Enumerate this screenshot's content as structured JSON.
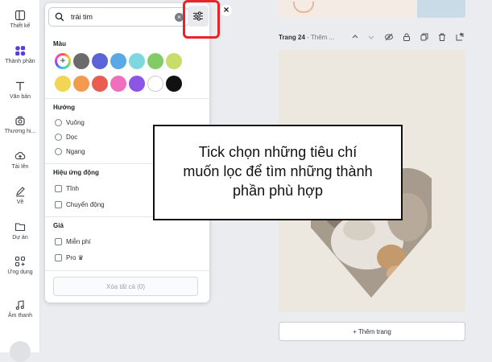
{
  "sidebar": {
    "items": [
      {
        "label": "Thiết kế",
        "icon": "layout-icon"
      },
      {
        "label": "Thành phần",
        "icon": "elements-icon"
      },
      {
        "label": "Văn bản",
        "icon": "text-icon"
      },
      {
        "label": "Thương hi...",
        "icon": "brand-icon"
      },
      {
        "label": "Tải lên",
        "icon": "upload-icon"
      },
      {
        "label": "Vẽ",
        "icon": "draw-icon"
      },
      {
        "label": "Dự án",
        "icon": "folder-icon"
      },
      {
        "label": "Ứng dụng",
        "icon": "apps-icon"
      },
      {
        "label": "Âm thanh",
        "icon": "music-icon"
      }
    ]
  },
  "search": {
    "value": "trái tim",
    "clear_label": "×"
  },
  "close_label": "×",
  "filters": {
    "color": {
      "title": "Màu",
      "swatches": [
        "#6b6b6b",
        "#5b63d6",
        "#5aa8e8",
        "#7ed8e0",
        "#82cc66",
        "#c8dd6a",
        "#f2d553",
        "#f29b4f",
        "#e85c52",
        "#ef6fbd",
        "#8b55e6",
        "#ffffff",
        "#111111"
      ],
      "add_label": "+"
    },
    "orientation": {
      "title": "Hướng",
      "options": [
        "Vuông",
        "Dọc",
        "Ngang"
      ]
    },
    "animation": {
      "title": "Hiệu ứng động",
      "options": [
        "Tĩnh",
        "Chuyển động"
      ]
    },
    "price": {
      "title": "Giá",
      "options": [
        "Miễn phí",
        "Pro ♛"
      ]
    },
    "clear_all": "Xóa tất cả (0)"
  },
  "editor": {
    "page_label": "Trang 24",
    "page_title_placeholder": " - Thêm ...",
    "add_page": "+ Thêm trang"
  },
  "callout": {
    "lines": [
      "Tick chọn những tiêu chí",
      "muốn lọc để tìm những thành",
      "phần phù hợp"
    ]
  },
  "colors": {
    "highlight": "#e8232a",
    "accent": "#7d2ae8"
  }
}
